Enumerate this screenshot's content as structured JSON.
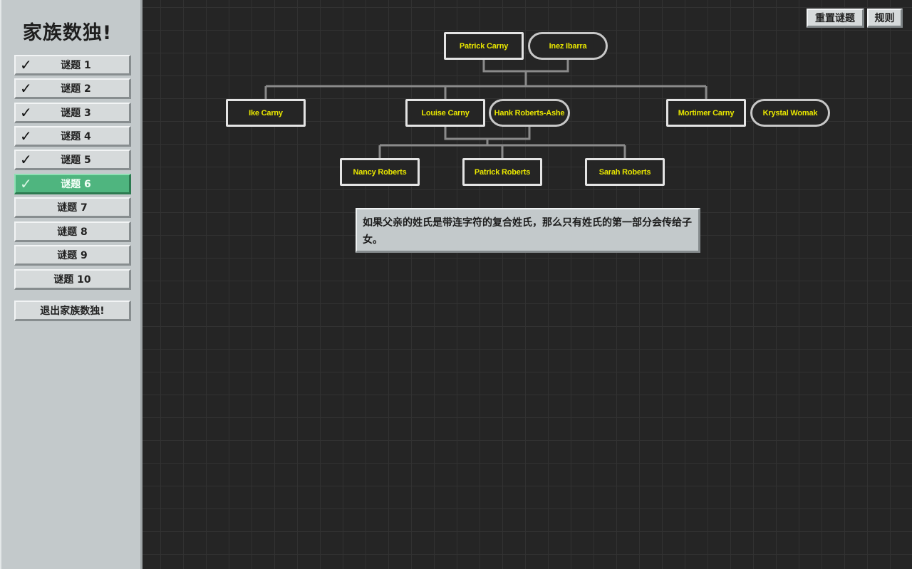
{
  "sidebar": {
    "title": "家族数独!",
    "puzzles": [
      {
        "label": "谜题 1",
        "completed": true
      },
      {
        "label": "谜题 2",
        "completed": true
      },
      {
        "label": "谜题 3",
        "completed": true
      },
      {
        "label": "谜题 4",
        "completed": true
      },
      {
        "label": "谜题 5",
        "completed": true
      },
      {
        "label": "谜题 6",
        "completed": true
      },
      {
        "label": "谜题 7",
        "completed": false
      },
      {
        "label": "谜题 8",
        "completed": false
      },
      {
        "label": "谜题 9",
        "completed": false
      },
      {
        "label": "谜题 10",
        "completed": false
      }
    ],
    "active_puzzle": "谜题 6",
    "check_glyph": "✓",
    "exit_label": "退出家族数独!"
  },
  "toolbar": {
    "reset_label": "重置谜题",
    "rules_label": "规则"
  },
  "tree": {
    "grandparents": {
      "father": "Patrick Carny",
      "mother": "Inez Ibarra"
    },
    "children": {
      "ike": "Ike Carny",
      "louise": "Louise Carny",
      "louise_spouse": "Hank Roberts-Ashe",
      "mortimer": "Mortimer Carny",
      "mortimer_spouse": "Krystal Womak"
    },
    "grandchildren": {
      "nancy": "Nancy Roberts",
      "patrick": "Patrick Roberts",
      "sarah": "Sarah Roberts"
    }
  },
  "clue": {
    "text": "如果父亲的姓氏是带连字符的复合姓氏，那么只有姓氏的第一部分会传给子女。"
  },
  "colors": {
    "active_puzzle_bg": "#4fb57f",
    "name_text": "#e8e600",
    "node_border": "#e4e4e4",
    "board_bg": "#252525",
    "panel_bg": "#c3c9cb"
  }
}
